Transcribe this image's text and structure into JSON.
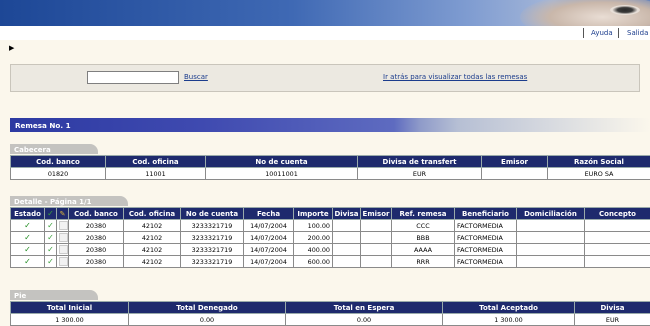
{
  "header": {
    "help_label": "Ayuda",
    "exit_label": "Salida"
  },
  "nav": {
    "arrow_icon": "play-arrow-icon"
  },
  "search": {
    "placeholder": "",
    "button_label": "Buscar",
    "back_link": "Ir atrás para visualizar todas las remesas"
  },
  "remesa": {
    "title": "Remesa No. 1"
  },
  "cabecera": {
    "tab_label": "Cabecera",
    "columns": [
      "Cod. banco",
      "Cod. oficina",
      "No de cuenta",
      "Divisa de transfert",
      "Emisor",
      "Razón Social"
    ],
    "row": [
      "01820",
      "11001",
      "10011001",
      "EUR",
      "",
      "EURO SA"
    ]
  },
  "detalle": {
    "tab_label": "Detalle - Página 1/1",
    "columns": [
      "Estado",
      "",
      "",
      "Cod. banco",
      "Cod. oficina",
      "No de cuenta",
      "Fecha",
      "Importe",
      "Divisa",
      "Emisor",
      "Ref. remesa",
      "Beneficiario",
      "Domiciliación",
      "Concepto"
    ],
    "status_icons": [
      "check-icon",
      "edit-icon",
      "note-icon"
    ],
    "rows": [
      {
        "cod_banco": "20380",
        "cod_oficina": "42102",
        "cuenta": "3233321719",
        "fecha": "14/07/2004",
        "importe": "100.00",
        "divisa": "",
        "emisor": "",
        "ref": "CCC",
        "beneficiario": "FACTORMEDIA",
        "domiciliacion": "",
        "concepto": ""
      },
      {
        "cod_banco": "20380",
        "cod_oficina": "42102",
        "cuenta": "3233321719",
        "fecha": "14/07/2004",
        "importe": "200.00",
        "divisa": "",
        "emisor": "",
        "ref": "BBB",
        "beneficiario": "FACTORMEDIA",
        "domiciliacion": "",
        "concepto": ""
      },
      {
        "cod_banco": "20380",
        "cod_oficina": "42102",
        "cuenta": "3233321719",
        "fecha": "14/07/2004",
        "importe": "400.00",
        "divisa": "",
        "emisor": "",
        "ref": "AAAA",
        "beneficiario": "FACTORMEDIA",
        "domiciliacion": "",
        "concepto": ""
      },
      {
        "cod_banco": "20380",
        "cod_oficina": "42102",
        "cuenta": "3233321719",
        "fecha": "14/07/2004",
        "importe": "600.00",
        "divisa": "",
        "emisor": "",
        "ref": "RRR",
        "beneficiario": "FACTORMEDIA",
        "domiciliacion": "",
        "concepto": ""
      }
    ]
  },
  "pie": {
    "tab_label": "Pie",
    "columns": [
      "Total Inicial",
      "Total Denegado",
      "Total en Espera",
      "Total Aceptado",
      "Divisa"
    ],
    "row": [
      "1 300.00",
      "0.00",
      "0.00",
      "1 300.00",
      "EUR"
    ]
  },
  "colors": {
    "header_bg": "#1e2a6d",
    "banner": "#1d4796",
    "page_bg": "#fbf7ec",
    "link": "#1b3c8c",
    "check": "#1d8a1d"
  }
}
